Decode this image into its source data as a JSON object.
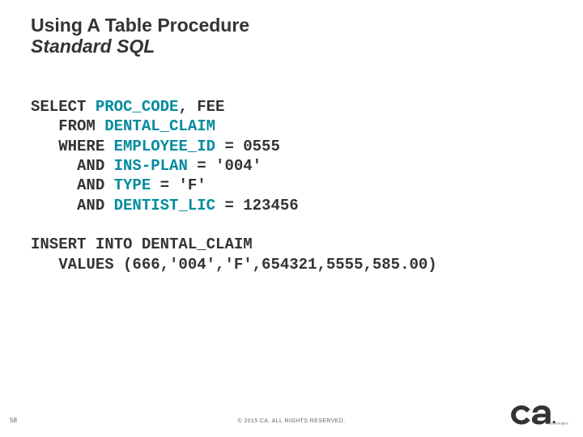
{
  "title": {
    "line1": "Using A Table Procedure",
    "line2": "Standard SQL"
  },
  "code": {
    "l1a": "SELECT ",
    "l1b": "PROC_CODE",
    "l1c": ", FEE",
    "l2a": "   FROM ",
    "l2b": "DENTAL_CLAIM",
    "l3a": "   WHERE ",
    "l3b": "EMPLOYEE_ID",
    "l3c": " = 0555",
    "l4a": "     AND ",
    "l4b": "INS-PLAN",
    "l4c": " = '004'",
    "l5a": "     AND ",
    "l5b": "TYPE",
    "l5c": " = 'F'",
    "l6a": "     AND ",
    "l6b": "DENTIST_LIC",
    "l6c": " = 123456",
    "blank": "",
    "l8": "INSERT INTO DENTAL_CLAIM",
    "l9": "   VALUES (666,'004','F',654321,5555,585.00)"
  },
  "footer": {
    "page": "58",
    "copyright": "© 2015 CA. ALL RIGHTS RESERVED.",
    "logo_text": "ca",
    "logo_sub": "technologies"
  }
}
